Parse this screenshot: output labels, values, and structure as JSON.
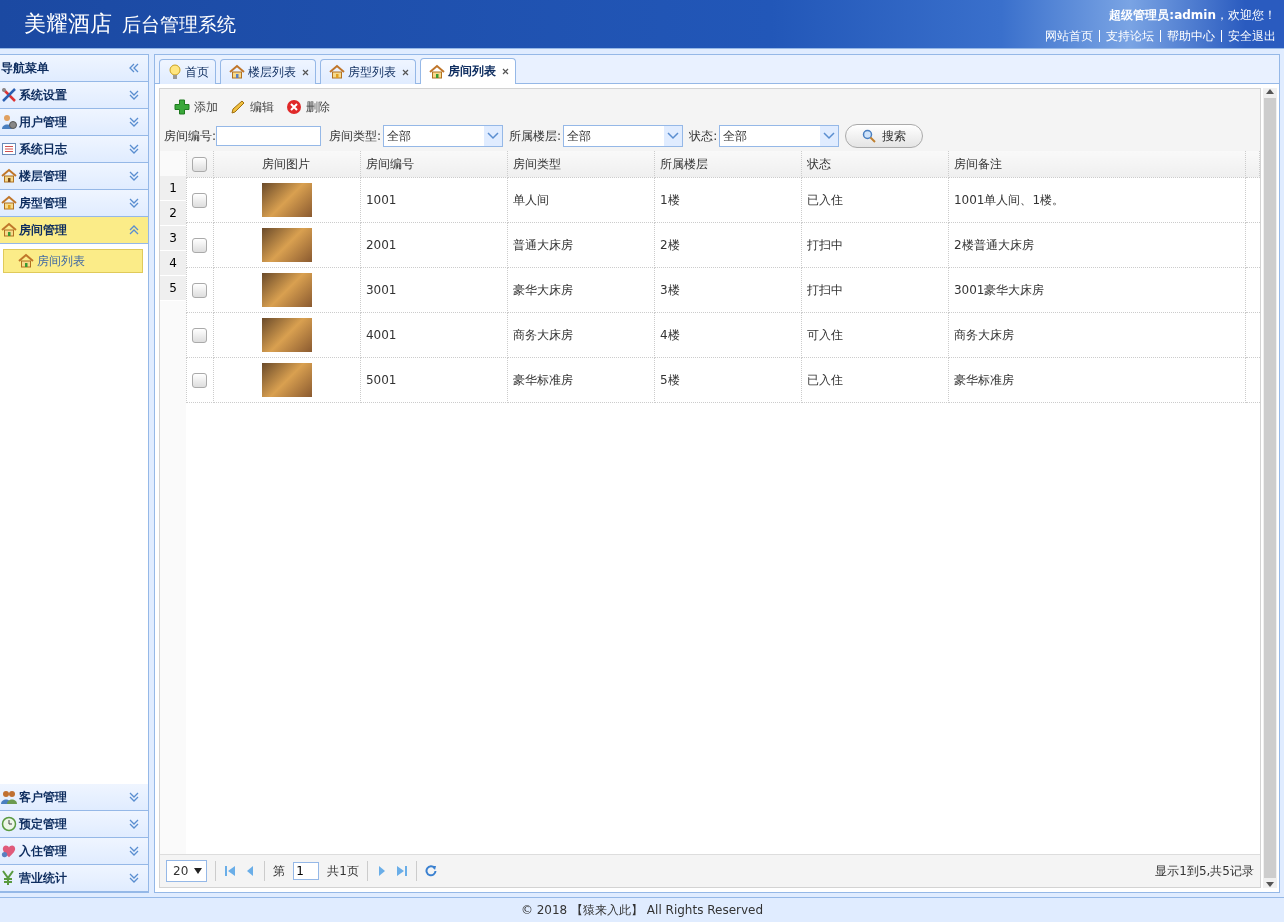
{
  "header": {
    "title": "美耀酒店",
    "subtitle": "后台管理系统",
    "greeting": "**超级管理员:admin**，欢迎您！",
    "links": [
      "网站首页",
      "支持论坛",
      "帮助中心",
      "安全退出"
    ]
  },
  "sidebar": {
    "title": "导航菜单",
    "groups": [
      {
        "label": "系统设置",
        "expanded": false
      },
      {
        "label": "用户管理",
        "expanded": false
      },
      {
        "label": "系统日志",
        "expanded": false
      },
      {
        "label": "楼层管理",
        "expanded": false
      },
      {
        "label": "房型管理",
        "expanded": false
      },
      {
        "label": "房间管理",
        "expanded": true,
        "children": [
          {
            "label": "房间列表",
            "selected": true
          }
        ]
      },
      {
        "label": "客户管理",
        "expanded": false
      },
      {
        "label": "预定管理",
        "expanded": false
      },
      {
        "label": "入住管理",
        "expanded": false
      },
      {
        "label": "营业统计",
        "expanded": false
      }
    ]
  },
  "tabs": [
    {
      "label": "首页",
      "selected": false,
      "closable": false
    },
    {
      "label": "楼层列表",
      "selected": false,
      "closable": true
    },
    {
      "label": "房型列表",
      "selected": false,
      "closable": true
    },
    {
      "label": "房间列表",
      "selected": true,
      "closable": true
    }
  ],
  "toolbar": {
    "buttons": [
      {
        "kind": "add",
        "label": "添加"
      },
      {
        "kind": "edit",
        "label": "编辑"
      },
      {
        "kind": "delete",
        "label": "删除"
      }
    ]
  },
  "filters": [
    {
      "kind": "text",
      "label": "房间编号:"
    },
    {
      "kind": "select",
      "label": "房间类型:",
      "value": "全部"
    },
    {
      "kind": "select",
      "label": "所属楼层:",
      "value": "全部"
    },
    {
      "kind": "select",
      "label": "状态:",
      "value": "全部"
    }
  ],
  "search_button": "搜索",
  "table": {
    "header_checked": false,
    "columns": [
      {
        "label": "房间图片",
        "kind": "photo"
      },
      {
        "label": "房间编号",
        "kind": "text"
      },
      {
        "label": "房间类型",
        "kind": "text"
      },
      {
        "label": "所属楼层",
        "kind": "text"
      },
      {
        "label": "状态",
        "kind": "text"
      },
      {
        "label": "房间备注",
        "kind": "text"
      }
    ],
    "row_numbers": [
      "1",
      "2",
      "3",
      "4",
      "5"
    ],
    "rows": [
      {
        "checked": false,
        "cells": [
          "",
          "1001",
          "单人间",
          "1楼",
          "已入住",
          "1001单人间、1楼。"
        ]
      },
      {
        "checked": false,
        "cells": [
          "",
          "2001",
          "普通大床房",
          "2楼",
          "打扫中",
          "2楼普通大床房"
        ]
      },
      {
        "checked": false,
        "cells": [
          "",
          "3001",
          "豪华大床房",
          "3楼",
          "打扫中",
          "3001豪华大床房"
        ]
      },
      {
        "checked": false,
        "cells": [
          "",
          "4001",
          "商务大床房",
          "4楼",
          "可入住",
          "商务大床房"
        ]
      },
      {
        "checked": false,
        "cells": [
          "",
          "5001",
          "豪华标准房",
          "5楼",
          "已入住",
          "豪华标准房"
        ]
      }
    ]
  },
  "pager": {
    "page_size": "20",
    "page_label": "第",
    "page": "1",
    "total_pages": "共1页",
    "summary": "显示1到5,共5记录"
  },
  "footer": "© 2018 【猿来入此】 All Rights Reserved"
}
